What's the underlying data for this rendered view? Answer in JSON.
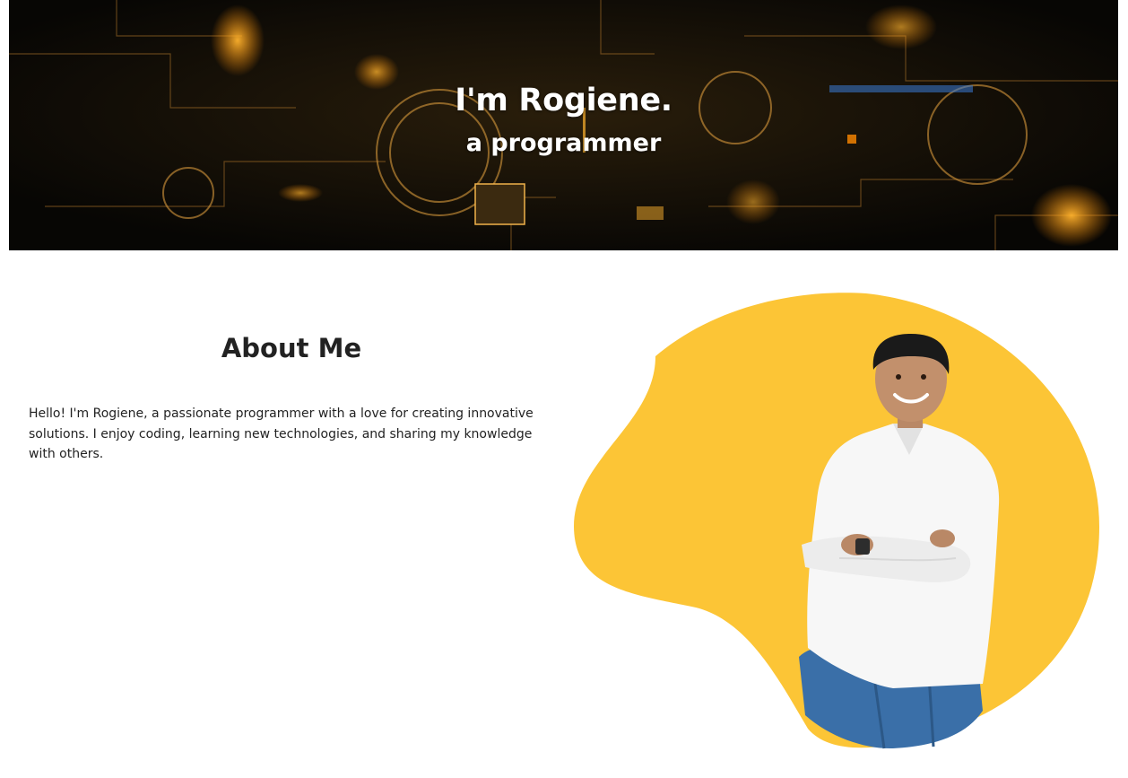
{
  "hero": {
    "title": "I'm Rogiene.",
    "subtitle": "a programmer"
  },
  "about": {
    "heading": "About Me",
    "paragraph": "Hello! I'm Rogiene, a passionate programmer with a love for creating innovative solutions. I enjoy coding, learning new technologies, and sharing my knowledge with others."
  },
  "colors": {
    "accent_blob": "#fcc536",
    "hero_glow": "#e8a126",
    "text_dark": "#222222"
  },
  "icons": {
    "hero_background": "circuit-board-image",
    "profile_photo": "person-photo"
  }
}
